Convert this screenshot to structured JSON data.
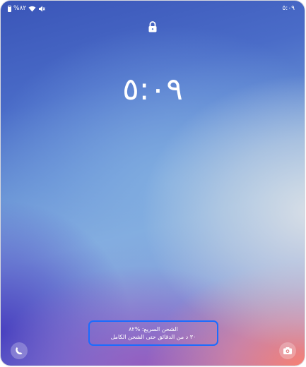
{
  "status_bar": {
    "battery_percent": "%٨٢",
    "battery_icon": "battery-icon",
    "wifi_icon": "wifi-icon",
    "mute_icon": "mute-icon",
    "time": "٥:٠٩"
  },
  "lockscreen": {
    "lock_icon": "lock-icon",
    "clock": "٥:٠٩"
  },
  "charging": {
    "line1": "الشحن السريع: %٨٢",
    "line2": "٣٠ د من الدقائق حتى الشحن الكامل"
  },
  "shortcuts": {
    "left_icon": "phone-icon",
    "right_icon": "camera-icon"
  },
  "colors": {
    "highlight": "#1a6cff"
  }
}
